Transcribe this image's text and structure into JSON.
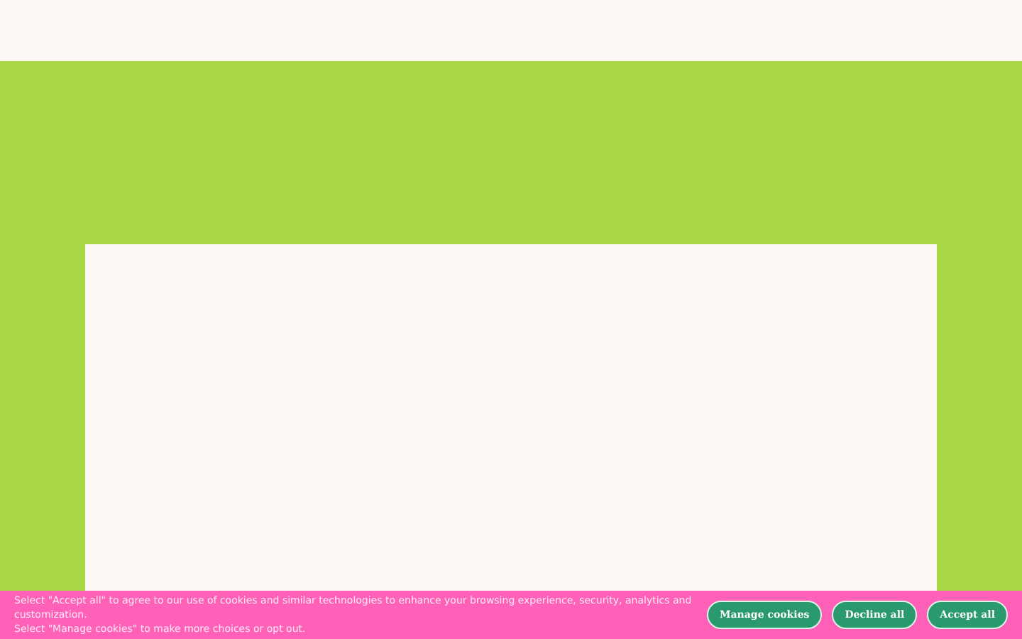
{
  "cookie_banner": {
    "message_lines": [
      "Select \"Accept all\" to agree to our use of cookies and similar technologies to enhance your browsing experience, security, analytics and customization.",
      "Select \"Manage cookies\" to make more choices or opt out."
    ],
    "buttons": [
      "Manage cookies",
      "Decline all",
      "Accept all"
    ]
  }
}
